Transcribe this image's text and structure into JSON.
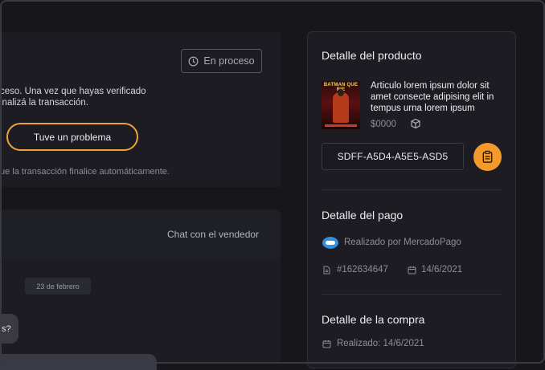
{
  "status": {
    "label": "En proceso",
    "icon": "clock-icon"
  },
  "message": {
    "line1": "ceso. Una vez que hayas verificado",
    "line2": "inalizá la transacción."
  },
  "problem_button": {
    "label": "Tuve un problema"
  },
  "auto_note": "ue la transacción finalice automáticamente.",
  "chat": {
    "title": "Chat con el vendedor",
    "date_chip": "23 de febrero",
    "bubble_fragment": "s?"
  },
  "product": {
    "section_title": "Detalle del producto",
    "cover_title": "BATMAN QUE RIE",
    "description_lines": [
      "Articulo lorem ipsum dolor sit",
      "amet consecte adipising elit in",
      "tempus urna lorem ipsum"
    ],
    "price": "$0000",
    "type_icon": "box-icon",
    "code": "SDFF-A5D4-A5E5-ASD5",
    "copy_icon": "clipboard-icon",
    "accent_color": "#f39a2b"
  },
  "payment": {
    "section_title": "Detalle del pago",
    "method": "Realizado por MercadoPago",
    "order_number": "#162634647",
    "date": "14/6/2021"
  },
  "purchase": {
    "section_title": "Detalle de la compra",
    "realized": "Realizado: 14/6/2021"
  }
}
